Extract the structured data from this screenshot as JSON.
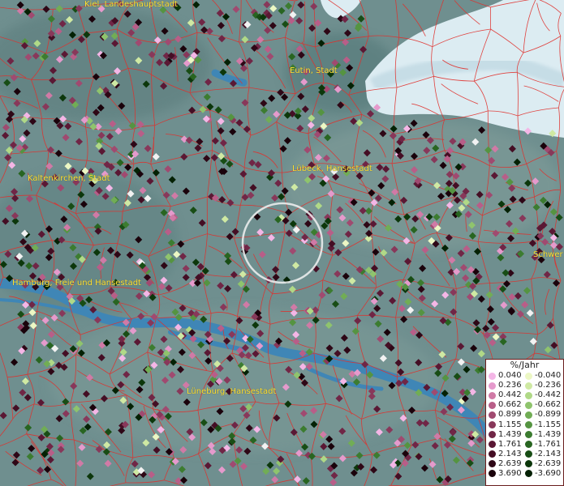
{
  "cities": [
    {
      "name": "Kiel, Landeshauptstadt"
    },
    {
      "name": "Eutin, Stadt"
    },
    {
      "name": "Lübeck, Hansestadt"
    },
    {
      "name": "Kaltenkirchen, Stadt"
    },
    {
      "name": "Hamburg, Freie und Hansestadt"
    },
    {
      "name": "Lüneburg, Hansestadt"
    },
    {
      "name": "Schwer"
    }
  ],
  "legend": {
    "title": "%/Jahr",
    "positive": [
      {
        "label": "0.040",
        "color": "#f4b6e6"
      },
      {
        "label": "0.236",
        "color": "#e59acc"
      },
      {
        "label": "0.442",
        "color": "#d07aa6"
      },
      {
        "label": "0.662",
        "color": "#b85e88"
      },
      {
        "label": "0.899",
        "color": "#a04a70"
      },
      {
        "label": "1.155",
        "color": "#88385a"
      },
      {
        "label": "1.439",
        "color": "#702646"
      },
      {
        "label": "1.761",
        "color": "#5a1834"
      },
      {
        "label": "2.143",
        "color": "#440e24"
      },
      {
        "label": "2.639",
        "color": "#2e0716"
      },
      {
        "label": "3.690",
        "color": "#1a020b"
      }
    ],
    "negative": [
      {
        "label": "-0.040",
        "color": "#ecf7c4"
      },
      {
        "label": "-0.236",
        "color": "#cfe9a3"
      },
      {
        "label": "-0.442",
        "color": "#b0d987"
      },
      {
        "label": "-0.662",
        "color": "#8fc46d"
      },
      {
        "label": "-0.899",
        "color": "#71ad55"
      },
      {
        "label": "-1.155",
        "color": "#559441"
      },
      {
        "label": "-1.439",
        "color": "#3c7c30"
      },
      {
        "label": "-1.761",
        "color": "#286521"
      },
      {
        "label": "-2.143",
        "color": "#184d15"
      },
      {
        "label": "-2.639",
        "color": "#0c370b"
      },
      {
        "label": "-3.690",
        "color": "#042104"
      }
    ]
  },
  "colors": {
    "land": "#6f8f8f",
    "water": "#3f86b6",
    "sea": "#dcecf2",
    "boundary": "#e0302c",
    "label": "#ffe033",
    "highlight_marker": "#f2f2f2"
  }
}
